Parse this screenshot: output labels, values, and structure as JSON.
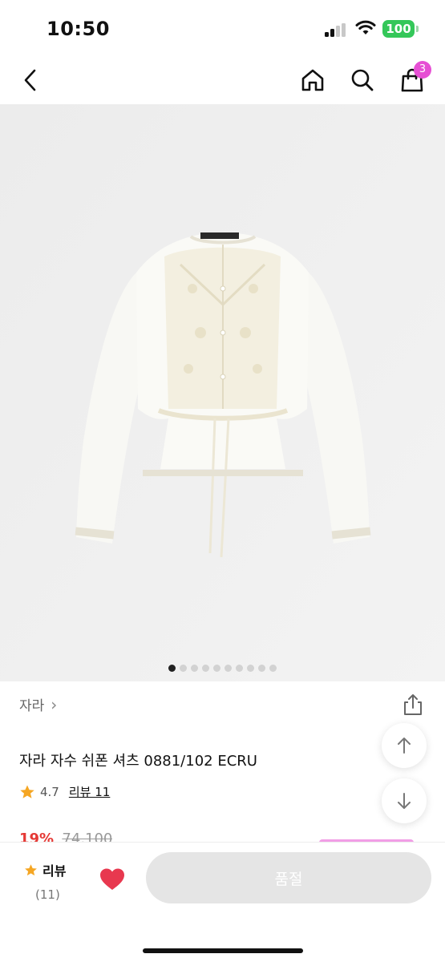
{
  "status_bar": {
    "time": "10:50",
    "battery": "100"
  },
  "nav": {
    "cart_count": "3"
  },
  "gallery": {
    "image_count": 10,
    "active_index": 0
  },
  "product": {
    "brand": "자라",
    "brand_chevron": "›",
    "title": "자라 자수 쉬폰 셔츠 0881/102 ECRU",
    "rating": "4.7",
    "review_link": "리뷰 11",
    "discount": "19%",
    "original_price": "74,100"
  },
  "bottom_bar": {
    "review_label": "리뷰",
    "review_count": "(11)",
    "soldout_label": "품절"
  },
  "colors": {
    "accent": "#e64fd4",
    "heart": "#e8384f",
    "star": "#f5a623",
    "button_disabled": "#e5e5e5"
  }
}
